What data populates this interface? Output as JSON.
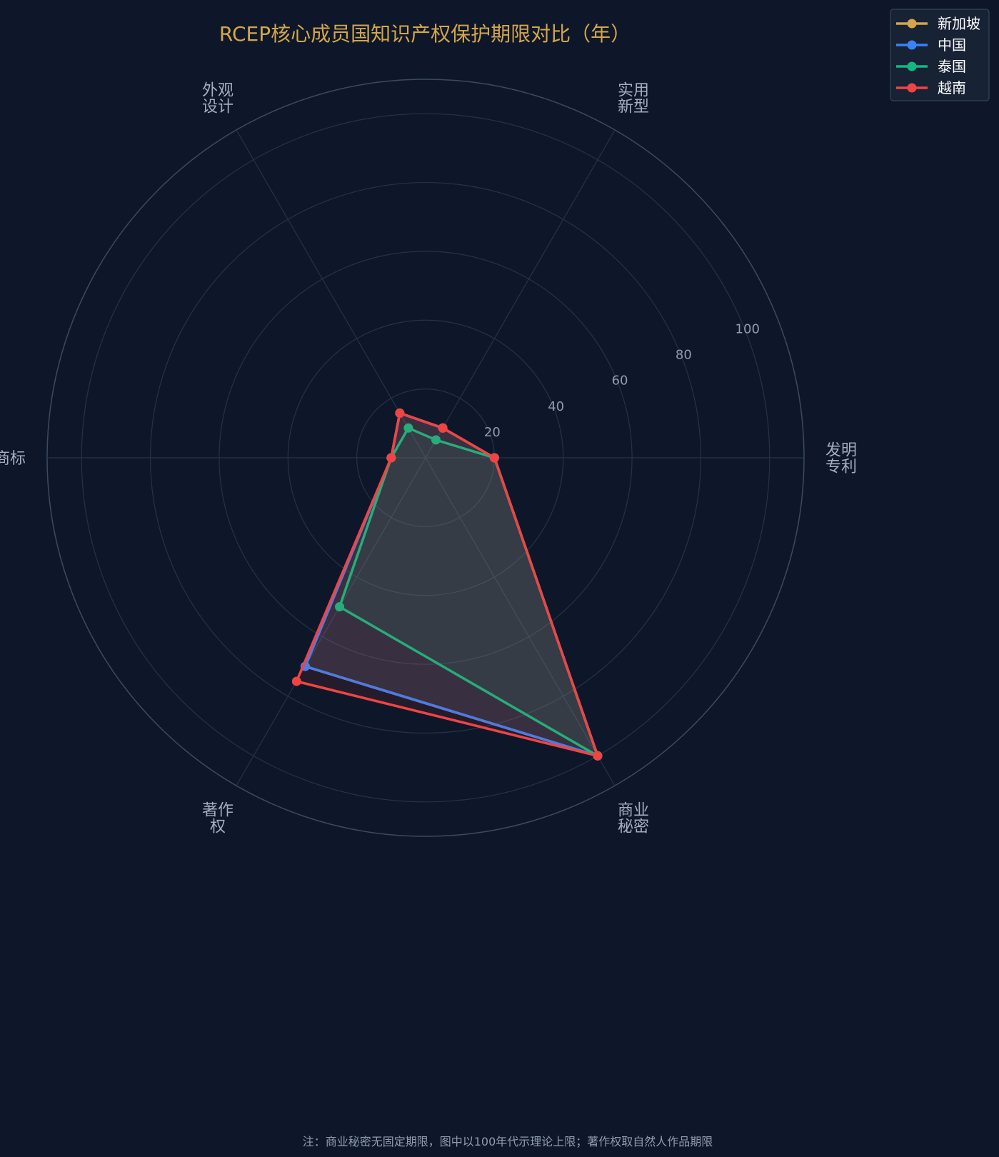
{
  "chart_data": {
    "type": "radar",
    "title": "RCEP核心成员国知识产权保护期限对比（年）",
    "axes": [
      [
        "发明",
        "专利"
      ],
      [
        "实用",
        "新型"
      ],
      [
        "外观",
        "设计"
      ],
      [
        "商标"
      ],
      [
        "著作",
        "权"
      ],
      [
        "商业",
        "秘密"
      ]
    ],
    "rlim": [
      0,
      110
    ],
    "ticks": [
      20,
      40,
      60,
      80,
      100
    ],
    "grid": true,
    "legend_position": "top-right",
    "series": [
      {
        "name": "新加坡",
        "color": "#d4a64a",
        "values": [
          20,
          10,
          15,
          10,
          70,
          100
        ]
      },
      {
        "name": "中国",
        "color": "#3b82f6",
        "values": [
          20,
          10,
          15,
          10,
          70,
          100
        ]
      },
      {
        "name": "泰国",
        "color": "#10b981",
        "values": [
          20,
          6,
          10,
          10,
          50,
          100
        ]
      },
      {
        "name": "越南",
        "color": "#ef4444",
        "values": [
          20,
          10,
          15,
          10,
          75,
          100
        ]
      }
    ],
    "footnote": "注：商业秘密无固定期限，图中以100年代示理论上限；著作权取自然人作品期限"
  }
}
